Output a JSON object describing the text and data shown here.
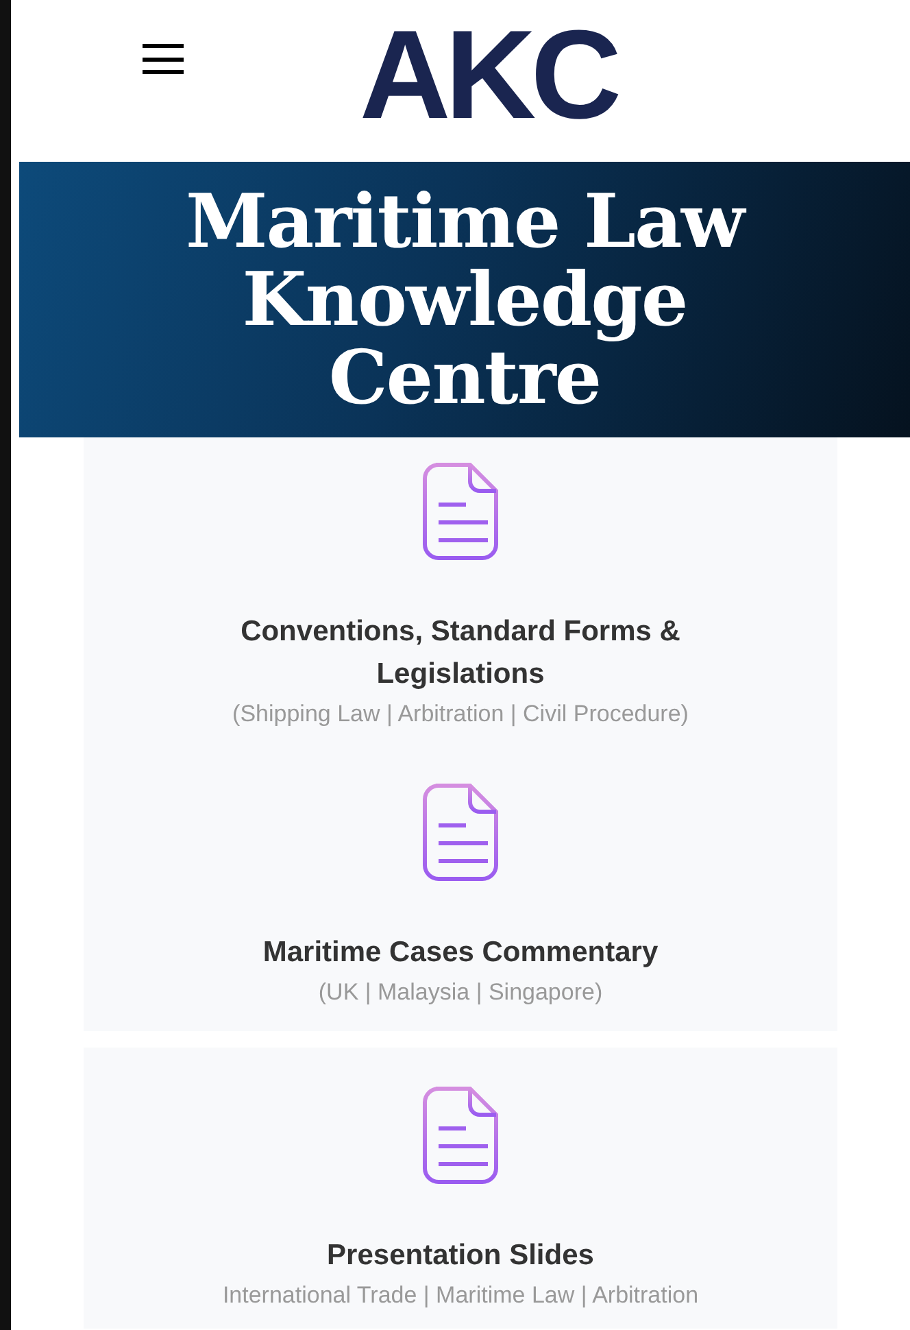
{
  "header": {
    "logo": "AKC"
  },
  "banner": {
    "title": "Maritime Law Knowledge Centre"
  },
  "items": [
    {
      "title": "Conventions, Standard Forms & Legislations",
      "subtitle": "(Shipping Law | Arbitration | Civil Procedure)"
    },
    {
      "title": "Maritime Cases Commentary",
      "subtitle": "(UK | Malaysia | Singapore)"
    },
    {
      "title": "Presentation Slides",
      "subtitle": "International Trade | Maritime Law | Arbitration"
    }
  ]
}
